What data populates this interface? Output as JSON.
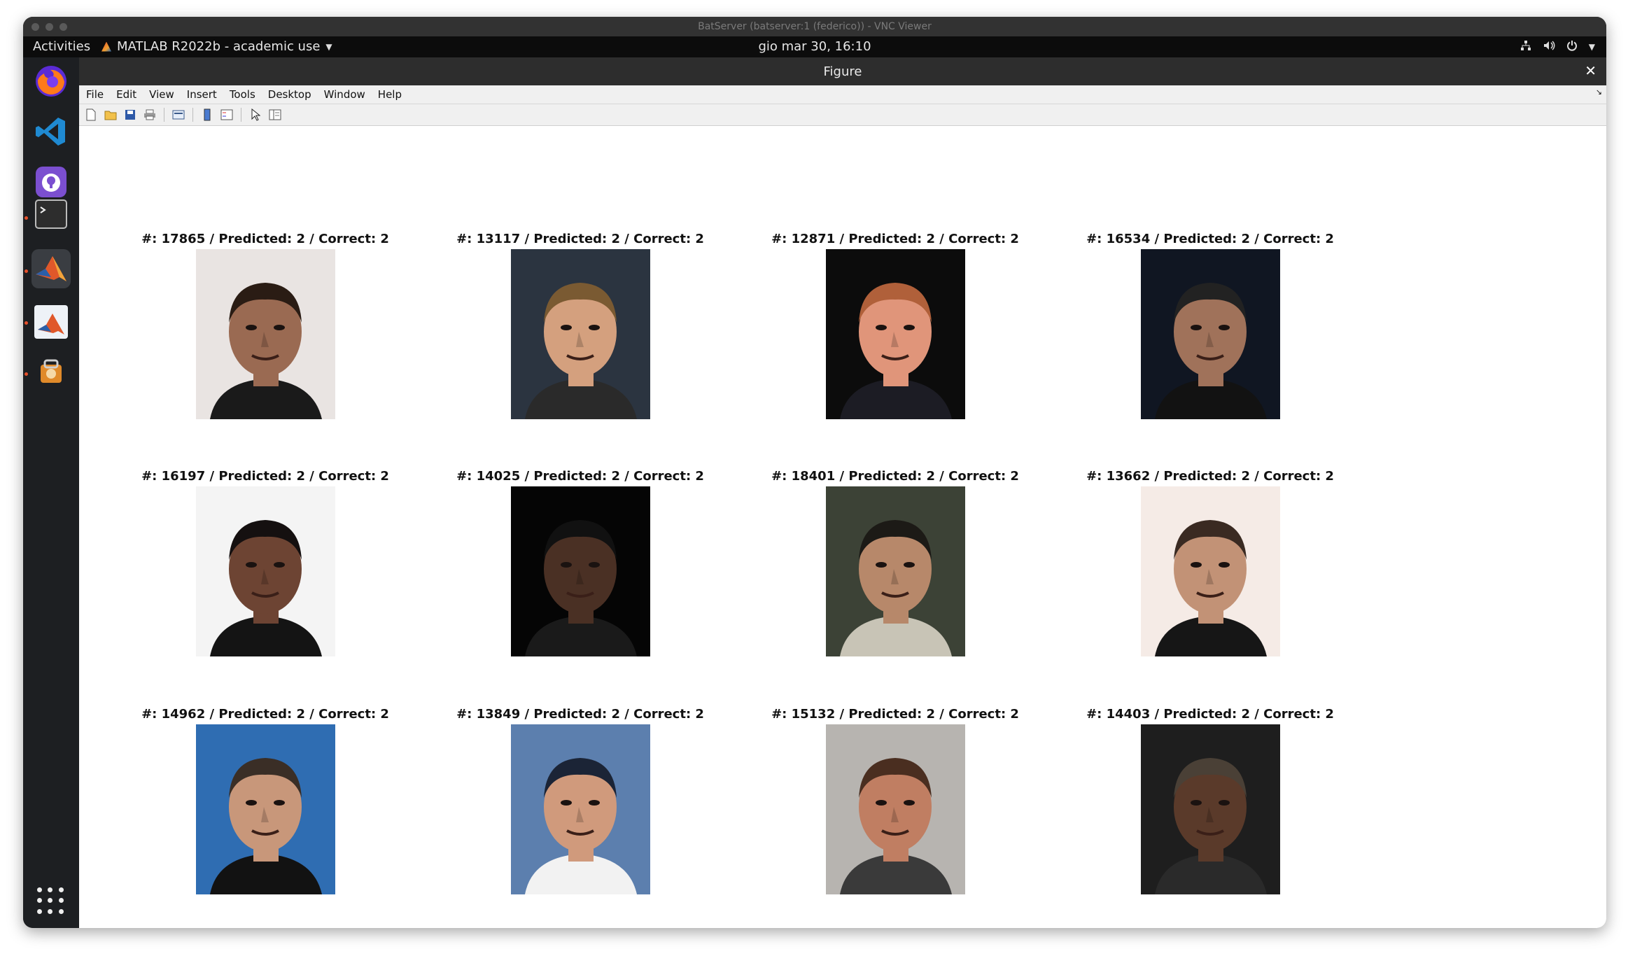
{
  "vnc": {
    "title": "BatServer (batserver:1 (federico)) - VNC Viewer"
  },
  "topbar": {
    "activities": "Activities",
    "app_name": "MATLAB R2022b - academic use",
    "clock": "gio mar 30, 16:10"
  },
  "dock": {
    "apps": [
      "firefox",
      "vscode",
      "github-desktop",
      "terminal",
      "file-cabinet",
      "matlab",
      "matlab",
      "software-updater"
    ]
  },
  "figure": {
    "title": "Figure",
    "menu": [
      "File",
      "Edit",
      "View",
      "Insert",
      "Tools",
      "Desktop",
      "Window",
      "Help"
    ],
    "tiles": [
      {
        "caption": "#: 17865 / Predicted: 2 / Correct: 2",
        "bg": "#e9e4e2",
        "skin": "#9a6a52",
        "hair": "#2a1c14",
        "shirt": "#1a1a1a"
      },
      {
        "caption": "#: 13117 / Predicted: 2 / Correct: 2",
        "bg": "#2b3440",
        "skin": "#d4a07e",
        "hair": "#7a5a32",
        "shirt": "#2a2a2a"
      },
      {
        "caption": "#: 12871 / Predicted: 2 / Correct: 2",
        "bg": "#0c0c0c",
        "skin": "#e0957a",
        "hair": "#b0603a",
        "shirt": "#1c1c24"
      },
      {
        "caption": "#: 16534 / Predicted: 2 / Correct: 2",
        "bg": "#101622",
        "skin": "#a0725a",
        "hair": "#222",
        "shirt": "#121212"
      },
      {
        "caption": "#: 16197 / Predicted: 2 / Correct: 2",
        "bg": "#f4f4f4",
        "skin": "#6d4433",
        "hair": "#151010",
        "shirt": "#141414"
      },
      {
        "caption": "#: 14025 / Predicted: 2 / Correct: 2",
        "bg": "#050505",
        "skin": "#4a3024",
        "hair": "#111",
        "shirt": "#1a1a1a"
      },
      {
        "caption": "#: 18401 / Predicted: 2 / Correct: 2",
        "bg": "#3c4236",
        "skin": "#b7886a",
        "hair": "#1c1a16",
        "shirt": "#c8c4b6"
      },
      {
        "caption": "#: 13662 / Predicted: 2 / Correct: 2",
        "bg": "#f5ebe6",
        "skin": "#c29276",
        "hair": "#3a2a22",
        "shirt": "#161616"
      },
      {
        "caption": "#: 14962 / Predicted: 2 / Correct: 2",
        "bg": "#2f6db2",
        "skin": "#c8977a",
        "hair": "#3a2e26",
        "shirt": "#121212"
      },
      {
        "caption": "#: 13849 / Predicted: 2 / Correct: 2",
        "bg": "#5c7fae",
        "skin": "#d09a7c",
        "hair": "#1b2436",
        "shirt": "#f2f2f2"
      },
      {
        "caption": "#: 15132 / Predicted: 2 / Correct: 2",
        "bg": "#b7b4b0",
        "skin": "#c07e62",
        "hair": "#4a2e20",
        "shirt": "#3a3a3a"
      },
      {
        "caption": "#: 14403 / Predicted: 2 / Correct: 2",
        "bg": "#1e1e1e",
        "skin": "#5a3a2a",
        "hair": "#4a4036",
        "shirt": "#2a2a2a"
      }
    ]
  }
}
